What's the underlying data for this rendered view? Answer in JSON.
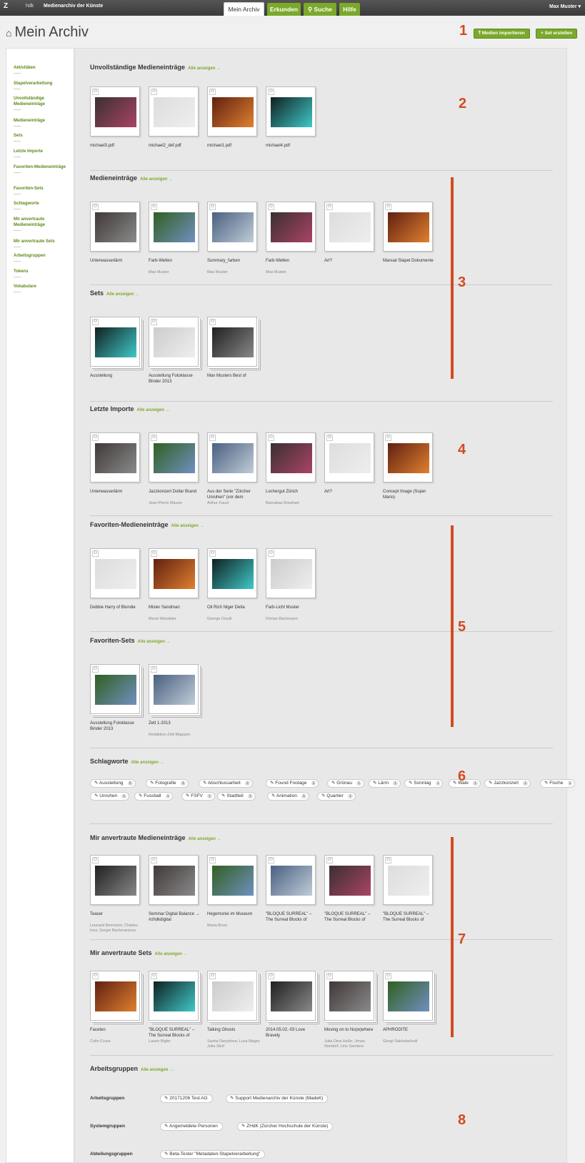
{
  "header": {
    "logo": "Z",
    "logo_sub": "hdk",
    "app_title": "Medienarchiv der Künste",
    "tabs": [
      "Mein Archiv",
      "Erkunden",
      "Suche",
      "Hilfe"
    ],
    "user": "Max Muster ▾"
  },
  "page": {
    "title": "Mein Archiv",
    "btn_import": "Medien importieren",
    "btn_create_set": "Set erstellen"
  },
  "show_all": "Alle anzeigen →",
  "sidebar": [
    "Aktivitäten",
    "Stapelverarbeitung",
    "Unvollständige Medieneinträge",
    "Medieneinträge",
    "Sets",
    "Letzte Importe",
    "Favoriten-Medieneinträge",
    "Favoriten-Sets",
    "Schlagworte",
    "Mir anvertraute Medieneinträge",
    "Mir anvertraute Sets",
    "Arbeitsgruppen",
    "Tokens",
    "Vokabulare"
  ],
  "sections": {
    "incomplete": {
      "title": "Unvollständige Medieneinträge",
      "items": [
        {
          "t": "michael3.pdf",
          "s": ""
        },
        {
          "t": "michael2_def.pdf",
          "s": ""
        },
        {
          "t": "michael1.pdf",
          "s": ""
        },
        {
          "t": "michael4.pdf",
          "s": ""
        }
      ]
    },
    "entries": {
      "title": "Medieneinträge",
      "items": [
        {
          "t": "Unterwasserlärm",
          "s": ""
        },
        {
          "t": "Farb-Welten",
          "s": "Max Muster"
        },
        {
          "t": "Summary_farben",
          "s": "Max Muster"
        },
        {
          "t": "Farb-Welten",
          "s": "Max Muster"
        },
        {
          "t": "Art?",
          "s": ""
        },
        {
          "t": "Manual Stapel Dokumente",
          "s": ""
        }
      ]
    },
    "sets": {
      "title": "Sets",
      "items": [
        {
          "t": "Ausstellung",
          "s": ""
        },
        {
          "t": "Ausstellung Fotoklasse Binder 2013",
          "s": ""
        },
        {
          "t": "Max Musters Best of",
          "s": ""
        }
      ]
    },
    "imports": {
      "title": "Letzte Importe",
      "items": [
        {
          "t": "Unterwasserlärm",
          "s": ""
        },
        {
          "t": "Jazzkonzert Dollar Brand",
          "s": "Jean-Pierre Maurer"
        },
        {
          "t": "Aus der Serie \"Zürcher Unruhen\" (vor dem",
          "s": "Arthur Faust"
        },
        {
          "t": "Lochergut Zürich",
          "s": "Barnabas Bosshart"
        },
        {
          "t": "Art?",
          "s": ""
        },
        {
          "t": "Concept Image (Super Mario)",
          "s": ""
        }
      ]
    },
    "fav_entries": {
      "title": "Favoriten-Medieneinträge",
      "items": [
        {
          "t": "Debbie Harry of Blondie",
          "s": ""
        },
        {
          "t": "Mister Sandman",
          "s": "Meret Wandeler"
        },
        {
          "t": "Oil Rich Niger Delta",
          "s": "George Osodi"
        },
        {
          "t": "Farb-Licht Muster",
          "s": "Florian Bachmann"
        }
      ]
    },
    "fav_sets": {
      "title": "Favoriten-Sets",
      "items": [
        {
          "t": "Ausstellung Fotoklasse Binder 2013",
          "s": ""
        },
        {
          "t": "Zett 1-2013",
          "s": "Redaktion Zett-Magazin"
        }
      ]
    },
    "keywords": {
      "title": "Schlagworte"
    },
    "trusted_entries": {
      "title": "Mir anvertraute Medieneinträge",
      "items": [
        {
          "t": "Teaser",
          "s": "Leonard Bernstein; Charles Ives; Sergei Rachmaninov"
        },
        {
          "t": "Seminar Digital Balance → #zhdkdigital",
          "s": ""
        },
        {
          "t": "Hegemonie im Museum",
          "s": "Maria Brosi"
        },
        {
          "t": "\"BLOQUE SURREAL\" – The Surreal Blocks of",
          "s": ""
        },
        {
          "t": "\"BLOQUE SURREAL\" – The Surreal Blocks of",
          "s": ""
        },
        {
          "t": "\"BLOQUE SURREAL\" – The Surreal Blocks of",
          "s": ""
        }
      ]
    },
    "trusted_sets": {
      "title": "Mir anvertraute Sets",
      "items": [
        {
          "t": "Faceten",
          "s": "Colin Cruse"
        },
        {
          "t": "\"BLOQUE SURREAL\" – The Surreal Blocks of",
          "s": "Laurin Bigler"
        },
        {
          "t": "Talking Ghosts",
          "s": "Sasha Davydova; Luca Magni; Julia Skof"
        },
        {
          "t": "2014.05.02.-03 Love Bravely",
          "s": ""
        },
        {
          "t": "Moving on to No(w)where",
          "s": "Julia Dina Heße; Jonas Nondorf; Linn Sanders"
        },
        {
          "t": "APHRODITE",
          "s": "Giorgi Sakhelashvili"
        }
      ]
    },
    "groups": {
      "title": "Arbeitsgruppen"
    }
  },
  "tags_row1": [
    [
      "Ausstellung",
      "5"
    ],
    [
      "Fotografie",
      "3"
    ],
    [
      "Abschlussarbeit",
      "2"
    ],
    [
      "Found Footage",
      "2"
    ],
    [
      "Grünau",
      "1"
    ],
    [
      "Lärm",
      "1"
    ],
    [
      "Sonntag",
      "1"
    ],
    [
      "Wale",
      "1"
    ],
    [
      "Jazzkonzert",
      "1"
    ],
    [
      "Fische",
      "1"
    ]
  ],
  "tags_row2": [
    [
      "Unruhen",
      "1"
    ],
    [
      "Fussball",
      "1"
    ],
    [
      "FSFV",
      "1"
    ],
    [
      "Stadtteil",
      "1"
    ],
    [
      "Animation",
      "1"
    ],
    [
      "Quartier",
      "1"
    ]
  ],
  "groups": [
    {
      "label": "Arbeitsgruppen",
      "tags": [
        "20171206 Test AG",
        "Support Medienarchiv der Künste (MadeK)"
      ]
    },
    {
      "label": "Systemgruppen",
      "tags": [
        "Angemeldete Personen",
        "ZHdK (Zürcher Hochschule der Künste)"
      ]
    },
    {
      "label": "Abteilungsgruppen",
      "tags": [
        "Beta-Tester \"Metadaten-Stapelverarbeitung\""
      ]
    }
  ],
  "markers": [
    "1",
    "2",
    "3",
    "4",
    "5",
    "6",
    "7",
    "8"
  ],
  "colors": {
    "accent": "#7ba92b",
    "marker": "#d34b1f"
  }
}
